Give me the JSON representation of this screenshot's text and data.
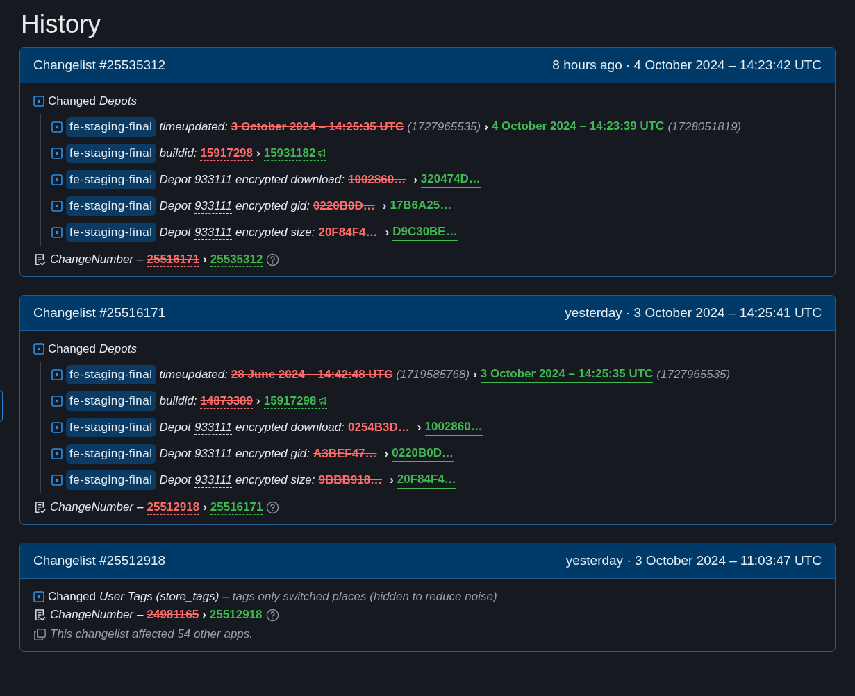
{
  "title": "History",
  "changelists": [
    {
      "title": "Changelist #25535312",
      "time": "8 hours ago · 4 October 2024 – 14:23:42 UTC",
      "group": {
        "verb": "Changed",
        "section": "Depots",
        "items": [
          {
            "kind": "time",
            "tag": "fe-staging-final",
            "key": "timeupdated:",
            "old": "3 October 2024 – 14:25:35 UTC",
            "old_raw": "(1727965535)",
            "arrow": "›",
            "new": "4 October 2024 – 14:23:39 UTC",
            "new_raw": "(1728051819)"
          },
          {
            "kind": "build",
            "tag": "fe-staging-final",
            "key": "buildid:",
            "old": "15917298",
            "arrow": "›",
            "new": "15931182"
          },
          {
            "kind": "hash",
            "tag": "fe-staging-final",
            "depot_label": "Depot",
            "depot": "933111",
            "key": "encrypted download:",
            "old": "1002860…",
            "arrow": "›",
            "new": "320474D…"
          },
          {
            "kind": "hash",
            "tag": "fe-staging-final",
            "depot_label": "Depot",
            "depot": "933111",
            "key": "encrypted gid:",
            "old": "0220B0D…",
            "arrow": "›",
            "new": "17B6A25…"
          },
          {
            "kind": "hash",
            "tag": "fe-staging-final",
            "depot_label": "Depot",
            "depot": "933111",
            "key": "encrypted size:",
            "old": "20F84F4…",
            "arrow": "›",
            "new": "D9C30BE…"
          }
        ]
      },
      "change_number": {
        "label": "ChangeNumber",
        "dash": "–",
        "old": "25516171",
        "arrow": "›",
        "new": "25535312"
      }
    },
    {
      "title": "Changelist #25516171",
      "time": "yesterday · 3 October 2024 – 14:25:41 UTC",
      "group": {
        "verb": "Changed",
        "section": "Depots",
        "items": [
          {
            "kind": "time",
            "tag": "fe-staging-final",
            "key": "timeupdated:",
            "old": "28 June 2024 – 14:42:48 UTC",
            "old_raw": "(1719585768)",
            "arrow": "›",
            "new": "3 October 2024 – 14:25:35 UTC",
            "new_raw": "(1727965535)"
          },
          {
            "kind": "build",
            "tag": "fe-staging-final",
            "key": "buildid:",
            "old": "14873389",
            "arrow": "›",
            "new": "15917298"
          },
          {
            "kind": "hash",
            "tag": "fe-staging-final",
            "depot_label": "Depot",
            "depot": "933111",
            "key": "encrypted download:",
            "old": "0254B3D…",
            "arrow": "›",
            "new": "1002860…"
          },
          {
            "kind": "hash",
            "tag": "fe-staging-final",
            "depot_label": "Depot",
            "depot": "933111",
            "key": "encrypted gid:",
            "old": "A3BEF47…",
            "arrow": "›",
            "new": "0220B0D…"
          },
          {
            "kind": "hash",
            "tag": "fe-staging-final",
            "depot_label": "Depot",
            "depot": "933111",
            "key": "encrypted size:",
            "old": "9BBB918…",
            "arrow": "›",
            "new": "20F84F4…"
          }
        ]
      },
      "change_number": {
        "label": "ChangeNumber",
        "dash": "–",
        "old": "25512918",
        "arrow": "›",
        "new": "25516171"
      }
    },
    {
      "title": "Changelist #25512918",
      "time": "yesterday · 3 October 2024 – 11:03:47 UTC",
      "group": {
        "verb": "Changed",
        "section": "User Tags (store_tags)",
        "dash": "–",
        "note": "tags only switched places (hidden to reduce noise)"
      },
      "change_number": {
        "label": "ChangeNumber",
        "dash": "–",
        "old": "24981165",
        "arrow": "›",
        "new": "25512918"
      },
      "affected": "This changelist affected 54 other apps."
    }
  ]
}
